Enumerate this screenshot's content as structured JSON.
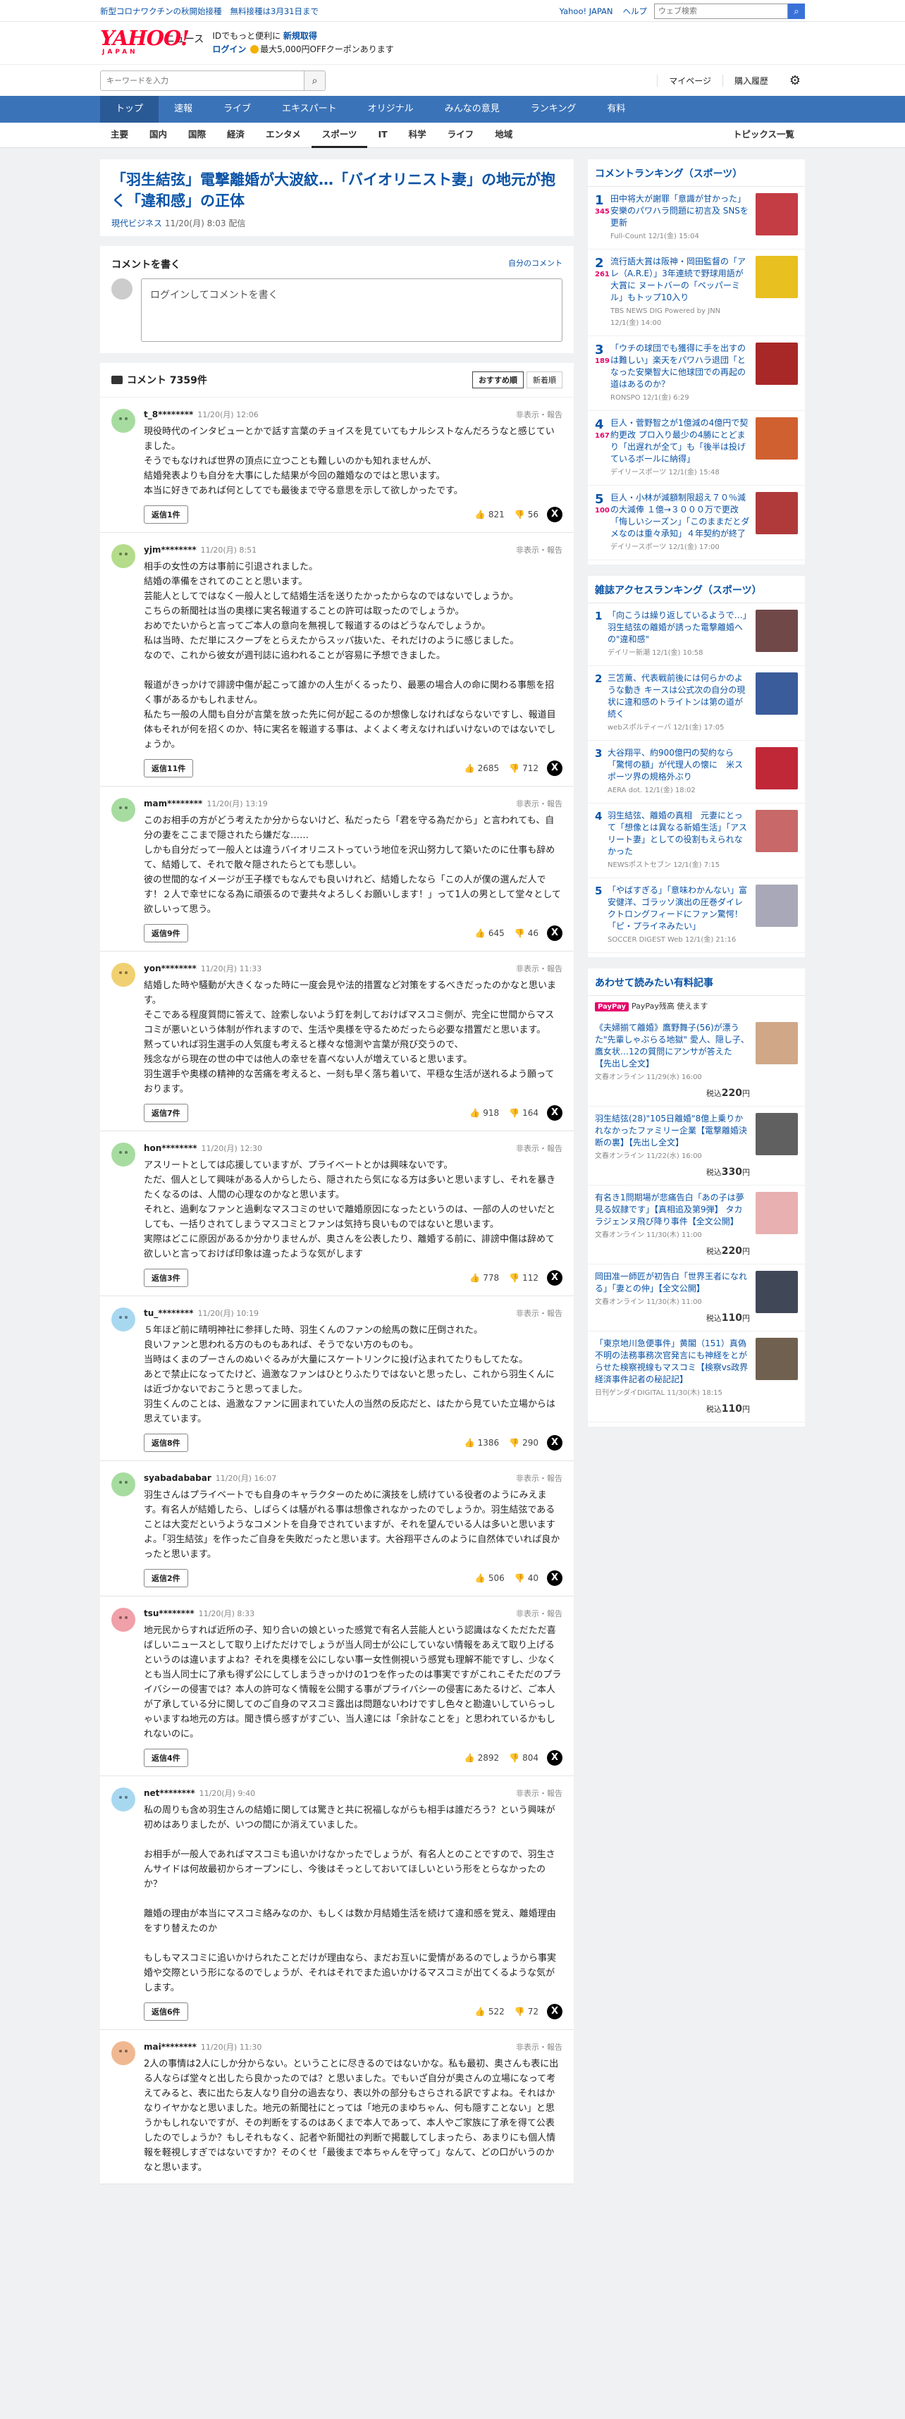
{
  "pre": {
    "promo1": "新型コロナワクチンの秋開始接種",
    "promo2": "無料接種は3月31日まで",
    "yjapan": "Yahoo! JAPAN",
    "help": "ヘルプ",
    "search_placeholder": "ウェブ検索"
  },
  "header": {
    "logo_text": "YAHOO!",
    "logo_sub": "JAPAN",
    "section": "ニュース",
    "msg1": "IDでもっと便利に",
    "msg1b": "新規取得",
    "msg2a": "ログイン",
    "msg2b": "最大5,000円OFFクーポンあります"
  },
  "sbar": {
    "placeholder": "キーワードを入力",
    "mypage": "マイページ",
    "history": "購入履歴"
  },
  "gnav": [
    "トップ",
    "速報",
    "ライブ",
    "エキスパート",
    "オリジナル",
    "みんなの意見",
    "ランキング",
    "有料"
  ],
  "snav": [
    "主要",
    "国内",
    "国際",
    "経済",
    "エンタメ",
    "スポーツ",
    "IT",
    "科学",
    "ライフ",
    "地域"
  ],
  "snav_right": "トピックス一覧",
  "article": {
    "title": "「羽生結弦」電撃離婚が大波紋…「バイオリニスト妻」の地元が抱く「違和感」の正体",
    "source": "現代ビジネス",
    "date": "11/20(月) 8:03 配信"
  },
  "compose": {
    "heading": "コメントを書く",
    "option": "自分のコメント",
    "login": "ログインしてコメントを書く"
  },
  "comments_header": {
    "title": "コメント 7359件",
    "sort1": "おすすめ順",
    "sort2": "新着順"
  },
  "comments": [
    {
      "user": "t_8********",
      "date": "11/20(月) 12:06",
      "text": "現役時代のインタビューとかで話す言葉のチョイスを見ていてもナルシストなんだろうなと感じていました。\nそうでもなければ世界の頂点に立つことも難しいのかも知れませんが、\n結婚発表よりも自分を大事にした結果が今回の離婚なのではと思います。\n本当に好きであれば何としてでも最後まで守る意思を示して欲しかったです。",
      "replies": "返信1件",
      "good": "821",
      "bad": "56",
      "color": "#a7dca0"
    },
    {
      "user": "yjm********",
      "date": "11/20(月) 8:51",
      "text": "相手の女性の方は事前に引退されました。\n結婚の準備をされてのことと思います。\n芸能人としてではなく一般人として結婚生活を送りたかったからなのではないでしょうか。\nこちらの新聞社は当の奥様に実名報道することの許可は取ったのでしょうか。\nおめでたいからと言ってご本人の意向を無視して報道するのはどうなんでしょうか。\n私は当時、ただ単にスクープをとらえたからスッパ抜いた、それだけのように感じました。\nなので、これから彼女が週刊誌に追われることが容易に予想できました。\n\n報道がきっかけで誹謗中傷が起こって誰かの人生がくるったり、最悪の場合人の命に関わる事態を招く事があるかもしれません。\n私たち一般の人間も自分が言葉を放った先に何が起こるのか想像しなければならないですし、報道目体もそれが何を招くのか、特に実名を報道する事は、よくよく考えなければいけないのではないでしょうか。",
      "replies": "返信11件",
      "good": "2685",
      "bad": "712",
      "color": "#b4dc8a"
    },
    {
      "user": "mam********",
      "date": "11/20(月) 13:19",
      "text": "このお相手の方がどう考えたか分からないけど、私だったら「君を守る為だから」と言われても、自分の妻をここまで隠されたら嫌だな……\nしかも自分だって一般人とは違うバイオリニストっていう地位を沢山努力して築いたのに仕事も辞めて、結婚して、それで散々隠されたらとても悲しい。\n彼の世間的なイメージが王子様でもなんでも良いけれど、結婚したなら「この人が僕の選んだ人です！２人で幸せになる為に頑張るので妻共々よろしくお願いします！」って1人の男として堂々として欲しいって思う。",
      "replies": "返信9件",
      "good": "645",
      "bad": "46",
      "color": "#a7dca0"
    },
    {
      "user": "yon********",
      "date": "11/20(月) 11:33",
      "text": "結婚した時や騒動が大きくなった時に一度会見や法的措置など対策をするべきだったのかなと思います。\nそこである程度質問に答えて、詮索しないよう釘を刺しておけばマスコミ側が、完全に世間からマスコミが悪いという体制が作れますので、生活や奥様を守るためだったら必要な措置だと思います。\n黙っていれば羽生選手の人気度も考えると様々な憶測や言葉が飛び交うので、\n残念ながら現在の世の中では他人の幸せを喜べない人が増えていると思います。\n羽生選手や奥様の精神的な苦痛を考えると、一刻も早く落ち着いて、平穏な生活が送れるよう願っております。",
      "replies": "返信7件",
      "good": "918",
      "bad": "164",
      "color": "#f0d070"
    },
    {
      "user": "hon********",
      "date": "11/20(月) 12:30",
      "text": "アスリートとしては応援していますが、プライベートとかは興味ないです。\nただ、個人として興味がある人からしたら、隠されたら気になる方は多いと思いますし、それを暴きたくなるのは、人間の心理なのかなと思います。\nそれと、過剰なファンと過剰なマスコミのせいで離婚原因になったというのは、一部の人のせいだとしても、一括りされてしまうマスコミとファンは気持ち良いものではないと思います。\n実際はどこに原因があるか分かりませんが、奥さんを公表したり、離婚する前に、誹謗中傷は辞めて欲しいと言っておけば印象は違ったような気がします",
      "replies": "返信3件",
      "good": "778",
      "bad": "112",
      "color": "#a7dca0"
    },
    {
      "user": "tu_********",
      "date": "11/20(月) 10:19",
      "text": "５年ほど前に晴明神社に参拝した時、羽生くんのファンの絵馬の数に圧倒された。\n良いファンと思われる方のものもあれば、そうでない方のものも。\n当時はくまのプーさんのぬいぐるみが大量にスケートリンクに投げ込まれてたりもしてたな。\nあとで禁止になってたけど、過激なファンはひとりふたりではないと思ったし、これから羽生くんには近づかないでおこうと思ってました。\n羽生くんのことは、過激なファンに囲まれていた人の当然の反応だと、はたから見ていた立場からは思えています。",
      "replies": "返信8件",
      "good": "1386",
      "bad": "290",
      "color": "#a8d8f0"
    },
    {
      "user": "syabadababar",
      "date": "11/20(月) 16:07",
      "text": "羽生さんはプライベートでも自身のキャラクターのために演技をし続けている役者のようにみえます。有名人が結婚したら、しばらくは騒がれる事は想像されなかったのでしょうか。羽生結弦であることは大変だというようなコメントを自身でされていますが、それを望んでいる人は多いと思いますよ。「羽生結弦」を作ったご自身を失敗だったと思います。大谷翔平さんのように自然体でいれば良かったと思います。",
      "replies": "返信2件",
      "good": "506",
      "bad": "40",
      "color": "#a7dca0"
    },
    {
      "user": "tsu********",
      "date": "11/20(月) 8:33",
      "text": "地元民からすれば近所の子、知り合いの娘といった感覚で有名人芸能人という認識はなくただただ喜ばしいニュースとして取り上げただけでしょうが当人同士が公にしていない情報をあえて取り上げるというのは違いますよね？それを奥様を公にしない事ー女性側視いう感覚も理解不能ですし、少なくとも当人同士に了承も得ず公にしてしまうきっかけの1つを作ったのは事実ですがこれこそただのプライバシーの侵害では？本人の許可なく情報を公開する事がプライバシーの侵害にあたるけど、ご本人が了承している分に関してのご自身のマスコミ露出は問題ないわけですし色々と勘違いしていらっしゃいますね地元の方は。聞き慣ら感すがすごい、当人達には「余計なことを」と思われているかもしれないのに。",
      "replies": "返信4件",
      "good": "2892",
      "bad": "804",
      "color": "#f0a0a8"
    },
    {
      "user": "net********",
      "date": "11/20(月) 9:40",
      "text": "私の周りも含め羽生さんの結婚に関しては驚きと共に祝福しながらも相手は誰だろう？という興味が初めはありましたが、いつの間にか消えていました。\n\nお相手が一般人であればマスコミも追いかけなかったでしょうが、有名人とのことですので、羽生さんサイドは何故最初からオープンにし、今後はそっとしておいてほしいという形をとらなかったのか？\n\n離婚の理由が本当にマスコミ絡みなのか、もしくは数か月結婚生活を続けて違和感を覚え、離婚理由をすり替えたのか\n\nもしもマスコミに追いかけられたことだけが理由なら、まだお互いに愛情があるのでしょうから事実婚や交際という形になるのでしょうが、それはそれでまた追いかけるマスコミが出てくるような気がします。",
      "replies": "返信6件",
      "good": "522",
      "bad": "72",
      "color": "#a8d8f0"
    },
    {
      "user": "mai********",
      "date": "11/20(月) 11:30",
      "text": "2人の事情は2人にしか分からない。ということに尽きるのではないかな。私も最初、奥さんも表に出る人ならば堂々と出したら良かったのでは？と思いました。でもいざ自分が奥さんの立場になって考えてみると、表に出たら友人なり自分の過去なり、表以外の部分もさらされる訳ですよね。それはかなりイヤかなと思いました。地元の新聞社にとっては「地元のまゆちゃん、何も隠すことない」と思うかもしれないですが、その判断をするのはあくまで本人であって、本人やご家族に了承を得て公表したのでしょうか？もしそれもなく、記者や新聞社の判断で掲載してしまったら、あまりにも個人情報を軽視しすぎではないですか？そのくせ「最後まで本ちゃんを守って」なんて、どの口がいうのかなと思います。",
      "replies": "",
      "good": "",
      "bad": "",
      "color": "#f0b890"
    }
  ],
  "ranking": {
    "title": "コメントランキング（スポーツ）",
    "items": [
      {
        "rank": "1",
        "count": "345",
        "text": "田中将大が謝罪「意識が甘かった」 安樂のパワハラ問題に初言及 SNSを更新",
        "src": "Full-Count 12/1(金) 15:04",
        "color": "#c43c44"
      },
      {
        "rank": "2",
        "count": "261",
        "text": "流行語大賞は阪神・岡田監督の「アレ（A.R.E）」3年連続で野球用語が大賞に ヌートバーの「ペッパーミル」もトップ10入り",
        "src": "TBS NEWS DIG Powered by JNN 12/1(金) 14:00",
        "color": "#e8c020"
      },
      {
        "rank": "3",
        "count": "189",
        "text": "「ウチの球団でも獲得に手を出すのは難しい」楽天をパワハラ退団「となった安樂智大に他球団での再起の道はあるのか？",
        "src": "RONSPO 12/1(金) 6:29",
        "color": "#a82828"
      },
      {
        "rank": "4",
        "count": "167",
        "text": "巨人・菅野智之が1億減の4億円で契約更改 プロ入り最少の4勝にとどまり「出遅れが全て」も「後半は投げているボールに納得」",
        "src": "デイリースポーツ 12/1(金) 15:48",
        "color": "#d06030"
      },
      {
        "rank": "5",
        "count": "100",
        "text": "巨人・小林が減額制限超え７０％減の大減俸 １億→３０００万で更改「悔しいシーズン」「このままだとダメなのは重々承知」４年契約が終了",
        "src": "デイリースポーツ 12/1(金) 17:00",
        "color": "#b03a3a"
      }
    ]
  },
  "access": {
    "title": "雑誌アクセスランキング（スポーツ）",
    "items": [
      {
        "rank": "1",
        "text": "「向こうは繰り返しているようで…」　羽生結弦の離婚が誘った電撃離婚への\"違和感\"",
        "src": "デイリー新潮 12/1(金) 10:58",
        "color": "#704848"
      },
      {
        "rank": "2",
        "text": "三笘薫、代表戦前後には何らかのような動き キースは公式次の自分の現状に違和感のトライトンは第の道が続く",
        "src": "webスポルティーバ 12/1(金) 17:05",
        "color": "#3a5c9a"
      },
      {
        "rank": "3",
        "text": "大谷翔平、約900億円の契約なら「驚愕の額」が代理人の懐に　米スポーツ界の規格外ぶり",
        "src": "AERA dot. 12/1(金) 18:02",
        "color": "#c02838"
      },
      {
        "rank": "4",
        "text": "羽生結弦、離婚の真相　元妻にとって「想像とは異なる新婚生活」「アスリート妻」としての役割もえられなかった",
        "src": "NEWSポストセブン 12/1(金) 7:15",
        "color": "#c86868"
      },
      {
        "rank": "5",
        "text": "「やばすぎる」「意味わかんない」富安健洋、ゴラッソ演出の圧巻ダイレクトロングフィードにファン驚愕！「ピ・プライネみたい」",
        "src": "SOCCER DIGEST Web 12/1(金) 21:16",
        "color": "#a8a8b8"
      }
    ]
  },
  "paid": {
    "title": "あわせて読みたい有料記事",
    "pp_badge": "PayPay",
    "pp_text": "PayPay残高 使えます",
    "items": [
      {
        "text": "《夫婦揃て離婚》鷹野舞子(56)が漂うた\"先輩しゃぶらる地獄\" 愛人、隠し子、鷹女状…12の質問にアンサが答えた　【先出し全文】",
        "src": "文春オンライン 11/29(水) 16:00",
        "price": "220",
        "color": "#d0a888"
      },
      {
        "text": "羽生結弦(28)\"105日離婚\"8億上乗りかれなかったファミリー企業【電撃離婚決断の裏】【先出し全文】",
        "src": "文春オンライン 11/22(水) 16:00",
        "price": "330",
        "color": "#606060"
      },
      {
        "text": "有名き1問期場が悲痛告白「あの子は夢見る奴隷です」【真相追及第9弾】 タカラジェンヌ飛び降り事件【全文公開】",
        "src": "文春オンライン 11/30(木) 11:00",
        "price": "220",
        "color": "#e8b0b0"
      },
      {
        "text": "岡田准一師匠が初告白「世界王者になれる」「妻との仲」【全文公開】",
        "src": "文春オンライン 11/30(木) 11:00",
        "price": "110",
        "color": "#404858"
      },
      {
        "text": "「東京地川急便事件」黄閣（151）真偽不明の法務事務次官発言にも神経をとがらせた検察視線もマスコミ【検察vs政界 経済事件記者の秘記記】",
        "src": "日刊ゲンダイDIGITAL 11/30(木) 18:15",
        "price": "110",
        "color": "#706050"
      }
    ]
  }
}
